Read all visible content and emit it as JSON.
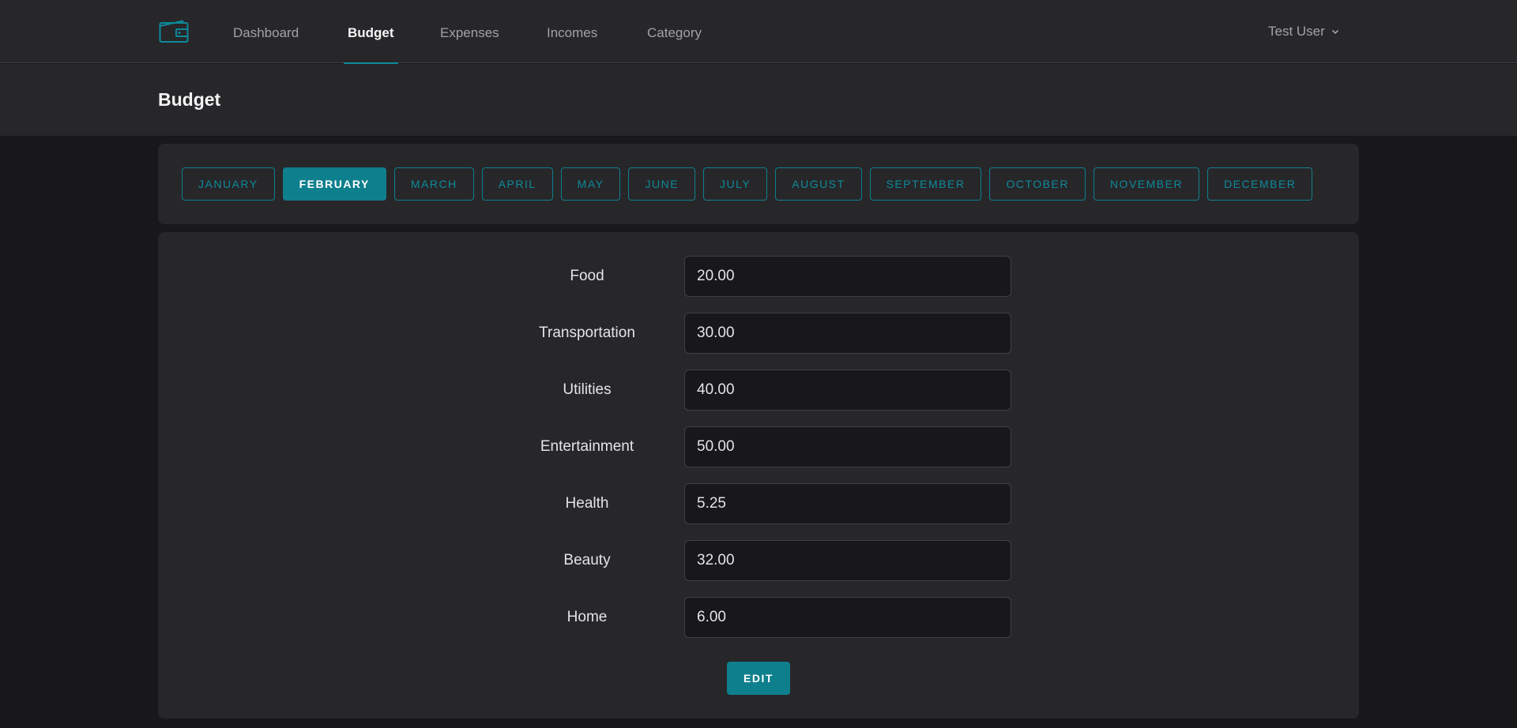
{
  "nav": {
    "links": [
      {
        "label": "Dashboard"
      },
      {
        "label": "Budget"
      },
      {
        "label": "Expenses"
      },
      {
        "label": "Incomes"
      },
      {
        "label": "Category"
      }
    ],
    "active": "Budget",
    "user": "Test User"
  },
  "page": {
    "title": "Budget"
  },
  "months": {
    "items": [
      "JANUARY",
      "FEBRUARY",
      "MARCH",
      "APRIL",
      "MAY",
      "JUNE",
      "JULY",
      "AUGUST",
      "SEPTEMBER",
      "OCTOBER",
      "NOVEMBER",
      "DECEMBER"
    ],
    "selected": "FEBRUARY"
  },
  "budget": {
    "rows": [
      {
        "label": "Food",
        "value": "20.00"
      },
      {
        "label": "Transportation",
        "value": "30.00"
      },
      {
        "label": "Utilities",
        "value": "40.00"
      },
      {
        "label": "Entertainment",
        "value": "50.00"
      },
      {
        "label": "Health",
        "value": "5.25"
      },
      {
        "label": "Beauty",
        "value": "32.00"
      },
      {
        "label": "Home",
        "value": "6.00"
      }
    ],
    "edit_label": "EDIT"
  },
  "colors": {
    "accent": "#0e7f8d",
    "background": "#18181b",
    "panel": "#27272a"
  },
  "icons": {
    "logo": "wallet-icon",
    "user_menu": "chevron-down-icon"
  }
}
